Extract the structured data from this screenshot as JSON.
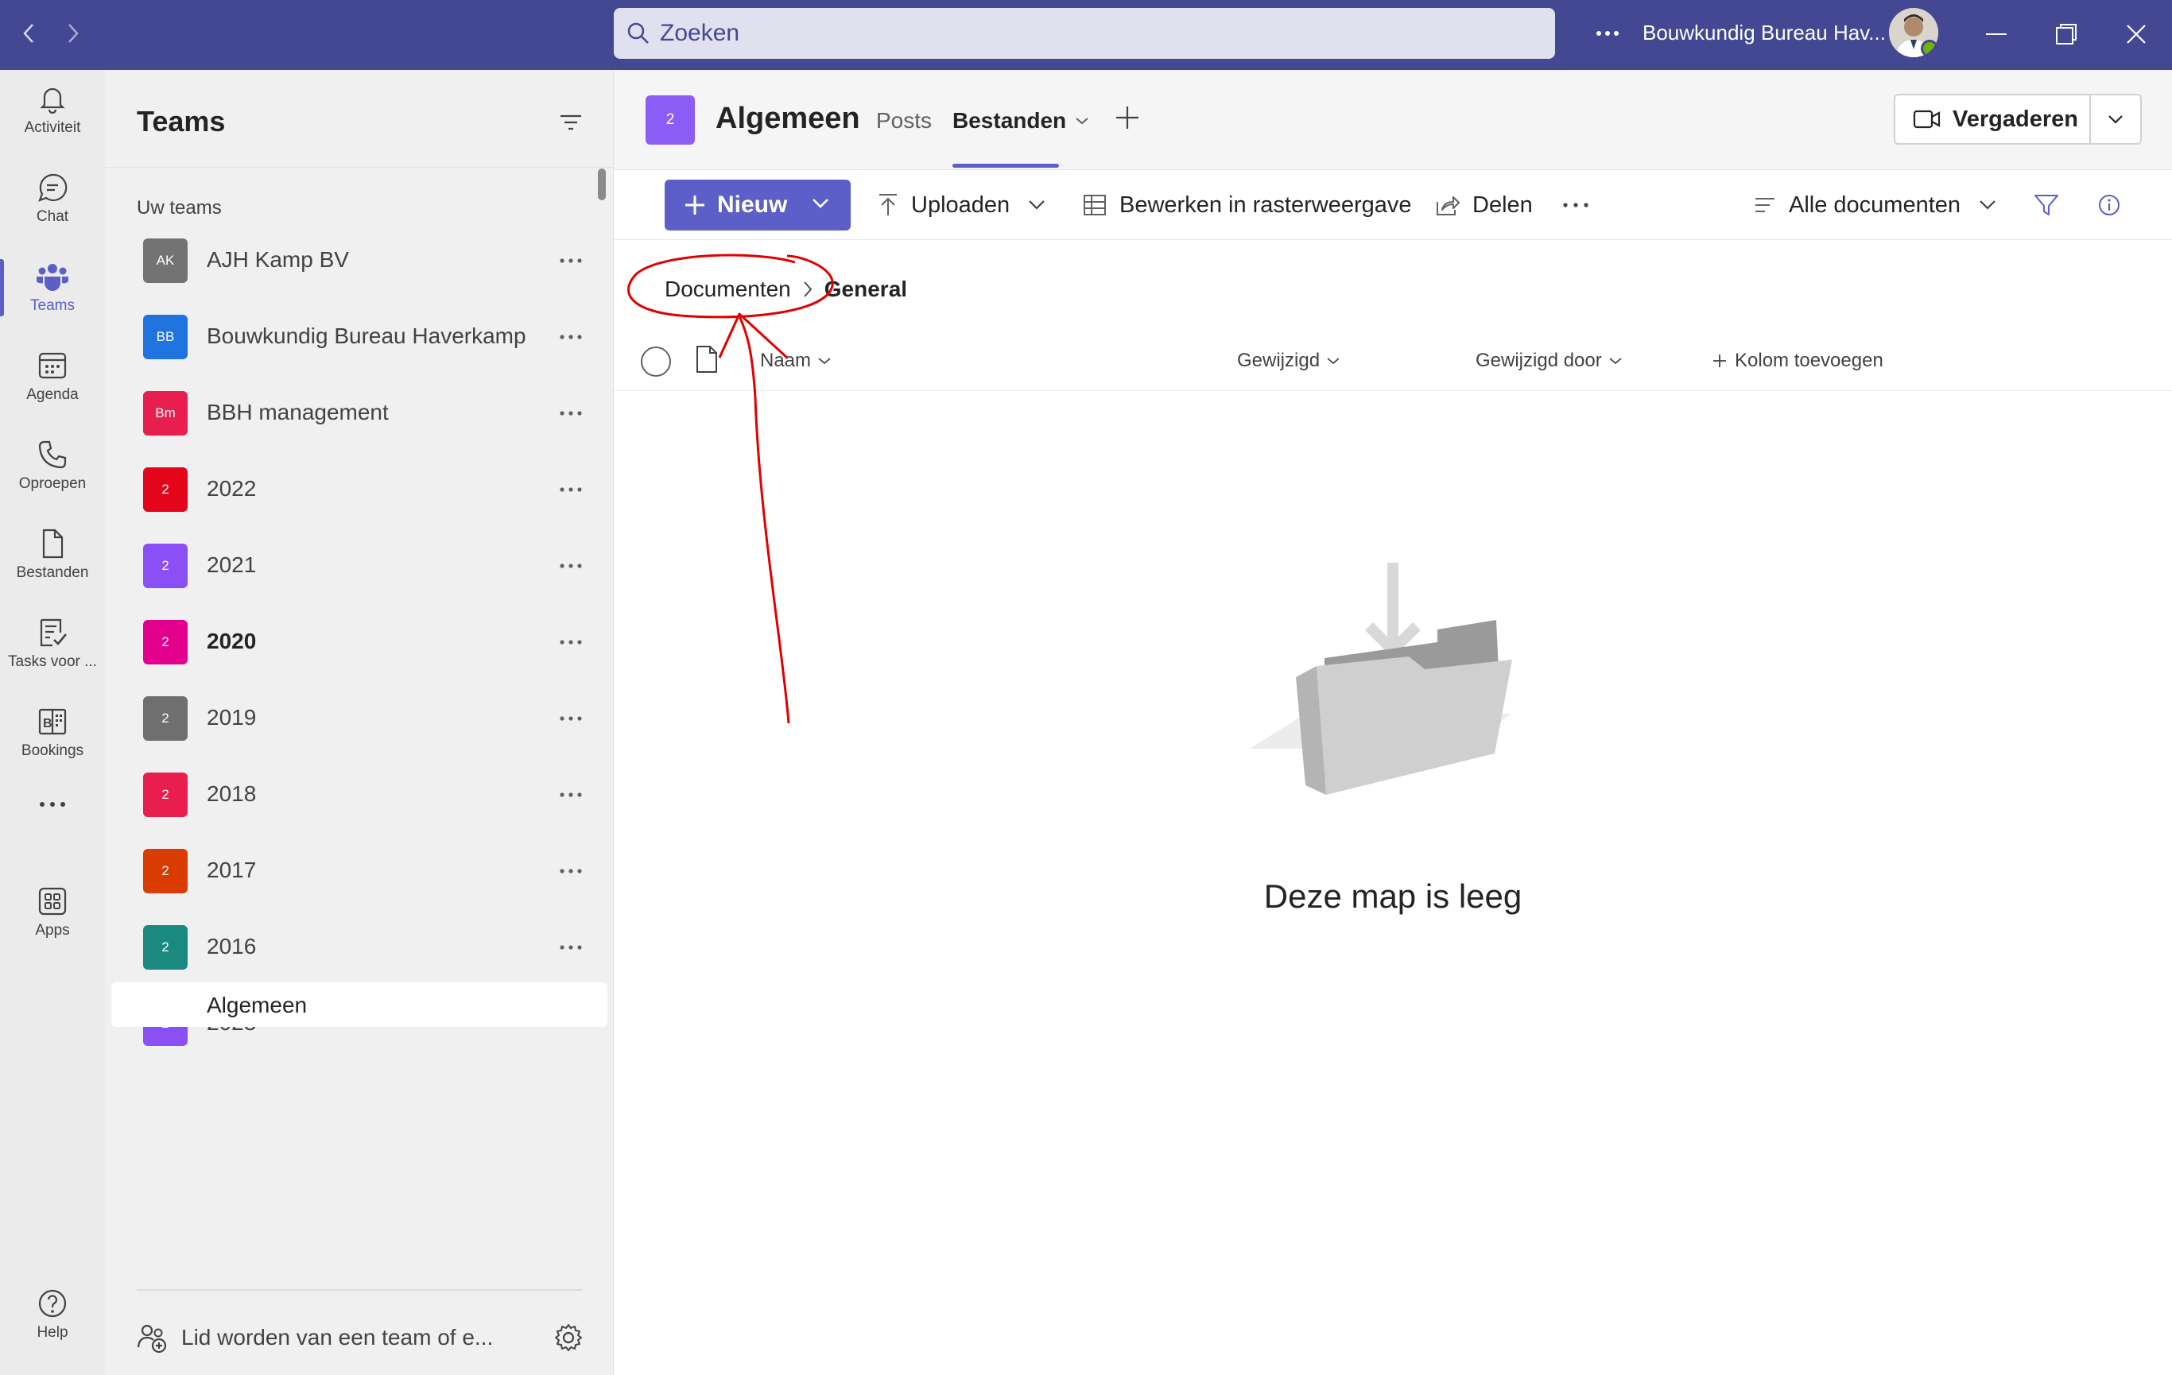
{
  "titlebar": {
    "search_placeholder": "Zoeken",
    "org_name": "Bouwkundig Bureau Hav...",
    "accent": "#444791"
  },
  "rail": {
    "items": [
      {
        "label": "Activiteit",
        "icon": "bell-icon"
      },
      {
        "label": "Chat",
        "icon": "chat-icon"
      },
      {
        "label": "Teams",
        "icon": "teams-icon",
        "active": true
      },
      {
        "label": "Agenda",
        "icon": "calendar-icon"
      },
      {
        "label": "Oproepen",
        "icon": "phone-icon"
      },
      {
        "label": "Bestanden",
        "icon": "file-icon"
      },
      {
        "label": "Tasks voor ...",
        "icon": "tasks-icon"
      },
      {
        "label": "Bookings",
        "icon": "bookings-icon"
      },
      {
        "label": "Apps",
        "icon": "apps-icon"
      },
      {
        "label": "Help",
        "icon": "help-icon"
      }
    ]
  },
  "panel": {
    "title": "Teams",
    "section_label": "Uw teams",
    "teams": [
      {
        "initials": "AK",
        "name": "AJH Kamp BV",
        "color": "#737373"
      },
      {
        "initials": "BB",
        "name": "Bouwkundig Bureau Haverkamp",
        "color": "#1f74e0"
      },
      {
        "initials": "Bm",
        "name": "BBH management",
        "color": "#e81e4e"
      },
      {
        "initials": "2",
        "name": "2022",
        "color": "#e3061b"
      },
      {
        "initials": "2",
        "name": "2021",
        "color": "#8a4ff5"
      },
      {
        "initials": "2",
        "name": "2020",
        "color": "#e3008c",
        "bold": true
      },
      {
        "initials": "2",
        "name": "2019",
        "color": "#6f6f6f"
      },
      {
        "initials": "2",
        "name": "2018",
        "color": "#e81e4e"
      },
      {
        "initials": "2",
        "name": "2017",
        "color": "#da3b01"
      },
      {
        "initials": "2",
        "name": "2016",
        "color": "#1a8a80"
      },
      {
        "initials": "2",
        "name": "2023",
        "color": "#8a4ff5"
      }
    ],
    "channel": "Algemeen",
    "join_label": "Lid worden van een team of e..."
  },
  "main": {
    "channel_tile": "2",
    "channel_name": "Algemeen",
    "tabs": [
      "Posts",
      "Bestanden"
    ],
    "meet_label": "Vergaderen",
    "toolbar": {
      "new_label": "Nieuw",
      "upload_label": "Uploaden",
      "grid_label": "Bewerken in rasterweergave",
      "share_label": "Delen",
      "view_label": "Alle documenten"
    },
    "breadcrumb": {
      "root": "Documenten",
      "current": "General"
    },
    "columns": [
      "Naam",
      "Gewijzigd",
      "Gewijzigd door",
      "Kolom toevoegen"
    ],
    "empty_message": "Deze map is leeg"
  }
}
